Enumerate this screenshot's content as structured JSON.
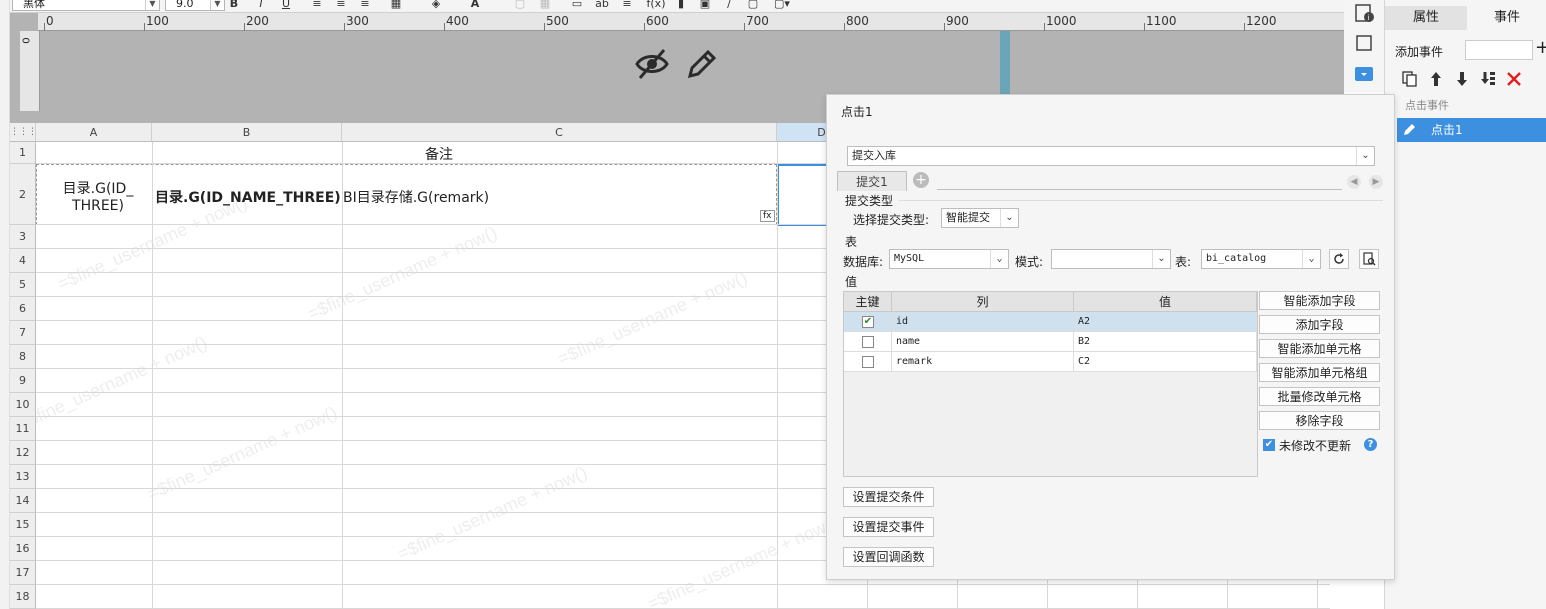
{
  "toolbar": {
    "font_name": "黑体",
    "font_size": "9.0",
    "bold": "B",
    "italic": "I",
    "underline": "U",
    "abc": "ab"
  },
  "ruler": {
    "labels": [
      "0",
      "100",
      "200",
      "300",
      "400",
      "500",
      "600",
      "700",
      "800",
      "900",
      "1000",
      "1100",
      "1200"
    ],
    "left_label": "0"
  },
  "sheet": {
    "columns": [
      "A",
      "B",
      "C",
      "D"
    ],
    "rows": [
      "1",
      "2",
      "3",
      "4",
      "5",
      "6",
      "7",
      "8",
      "9",
      "10",
      "11",
      "12",
      "13",
      "14",
      "15",
      "16",
      "17",
      "18"
    ],
    "c1_text": "备注",
    "a2_text_line1": "目录.G(ID_",
    "a2_text_line2": "THREE)",
    "b2_text": "目录.G(ID_NAME_THREE)",
    "c2_text": "BI目录存储.G(remark)",
    "fx_badge": "fx",
    "watermark": "=$fine_username + now()"
  },
  "right_panel": {
    "tab_properties": "属性",
    "tab_events": "事件",
    "add_event_label": "添加事件",
    "add_plus": "+",
    "section_label": "点击事件",
    "event_item": "点击1"
  },
  "dialog": {
    "title": "点击1",
    "action_select": "提交入库",
    "tab_label": "提交1",
    "submit_type_section": "提交类型",
    "submit_type_label": "选择提交类型:",
    "submit_type_value": "智能提交",
    "table_section": "表",
    "db_label": "数据库:",
    "db_value": "MySQL",
    "schema_label": "模式:",
    "schema_value": "",
    "table_label": "表:",
    "table_value": "bi_catalog",
    "value_section": "值",
    "col_headers": [
      "主键",
      "列",
      "值"
    ],
    "rows": [
      {
        "key": true,
        "column": "id",
        "value": "A2"
      },
      {
        "key": false,
        "column": "name",
        "value": "B2"
      },
      {
        "key": false,
        "column": "remark",
        "value": "C2"
      }
    ],
    "side_buttons": [
      "智能添加字段",
      "添加字段",
      "智能添加单元格",
      "智能添加单元格组",
      "批量修改单元格",
      "移除字段"
    ],
    "no_update_label": "未修改不更新",
    "help": "?",
    "bottom_buttons": [
      "设置提交条件",
      "设置提交事件",
      "设置回调函数"
    ]
  },
  "colors": {
    "accent": "#3d8fe0",
    "teal": "#6aa6b8",
    "close_red": "#e02020"
  }
}
